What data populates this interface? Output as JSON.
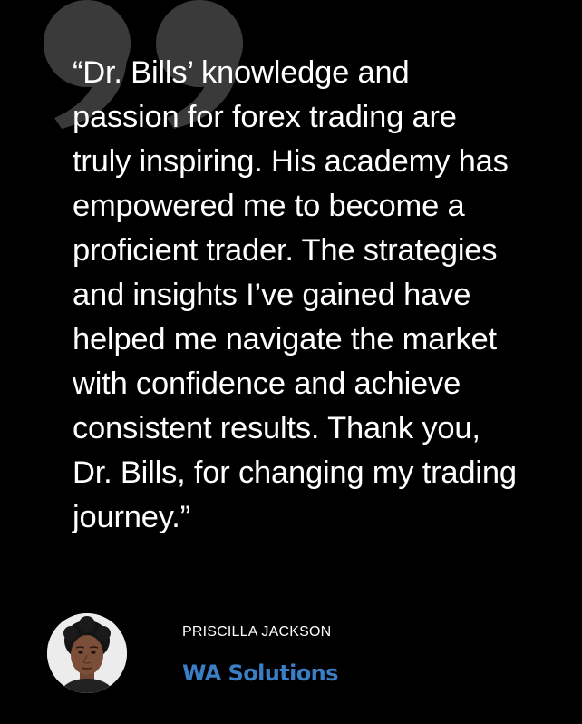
{
  "testimonial": {
    "quote": "“Dr. Bills’ knowledge and\npassion for forex trading are\ntruly inspiring. His academy has\nempowered me to become a\nproficient trader. The strategies\nand insights I’ve gained have\nhelped me navigate the market\nwith confidence and achieve\nconsistent results. Thank you,\nDr. Bills, for changing my trading\njourney.”",
    "quote_icon": "quote-mark-icon",
    "author_name": "PRISCILLA JACKSON",
    "company": "WA Solutions"
  },
  "colors": {
    "background": "#000000",
    "quote_mark": "#3a3a3a",
    "text": "#ffffff",
    "company": "#3a7ec6"
  }
}
